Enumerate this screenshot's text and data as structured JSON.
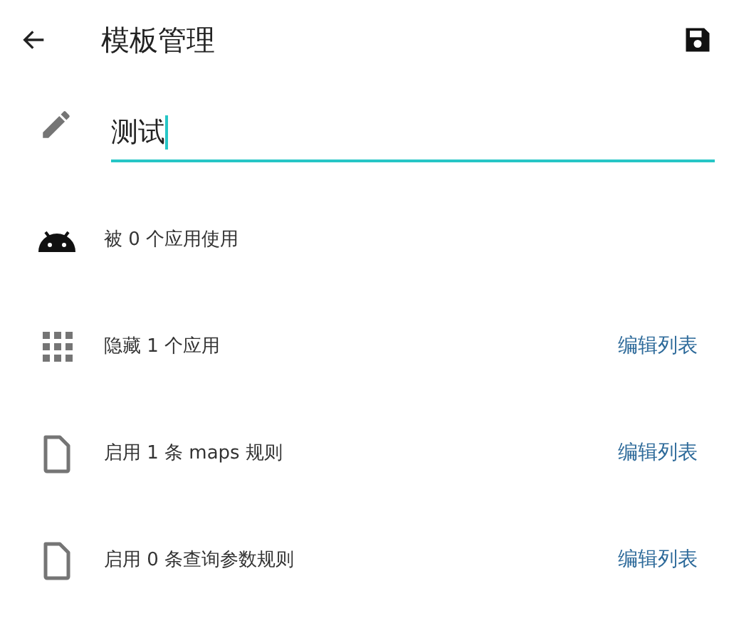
{
  "app_bar": {
    "title": "模板管理"
  },
  "name_field": {
    "value": "测试",
    "focused": true
  },
  "rows": [
    {
      "kind": "android",
      "text": "被 0 个应用使用"
    },
    {
      "kind": "grid",
      "text": "隐藏 1 个应用",
      "action": "编辑列表"
    },
    {
      "kind": "file",
      "text": "启用 1 条 maps 规则",
      "action": "编辑列表"
    },
    {
      "kind": "file",
      "text": "启用 0 条查询参数规则",
      "action": "编辑列表"
    }
  ]
}
